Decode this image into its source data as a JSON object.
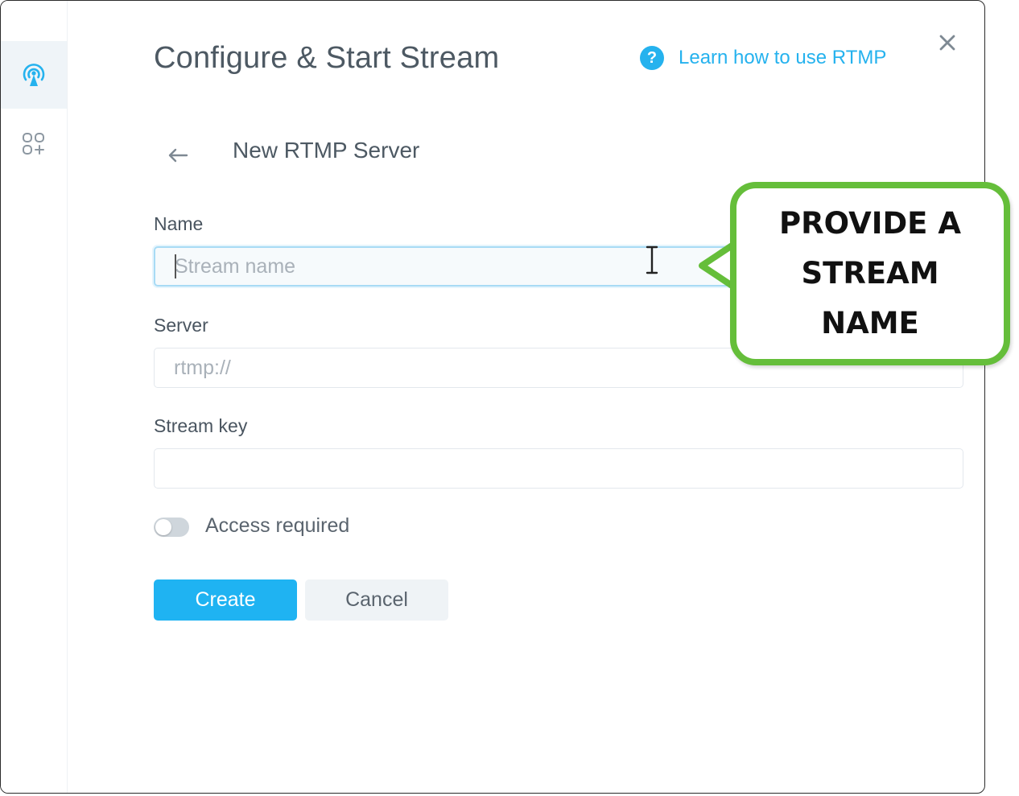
{
  "dialog": {
    "title": "Configure & Start Stream",
    "help_link": "Learn how to use RTMP",
    "help_icon_glyph": "?",
    "subtitle": "New RTMP Server"
  },
  "sidebar": {
    "items": [
      {
        "icon": "broadcast-icon",
        "active": true
      },
      {
        "icon": "add-app-icon",
        "active": false
      }
    ]
  },
  "form": {
    "name_label": "Name",
    "name_placeholder": "Stream name",
    "server_label": "Server",
    "server_placeholder": "rtmp://",
    "key_label": "Stream key",
    "key_placeholder": "",
    "access_label": "Access required",
    "access_required": false,
    "create_label": "Create",
    "cancel_label": "Cancel"
  },
  "callout": {
    "lines": [
      "PROVIDE A",
      "STREAM",
      "NAME"
    ]
  },
  "colors": {
    "accent": "#1fb3f2",
    "callout_border": "#65be3a",
    "title_text": "#4d5963"
  }
}
